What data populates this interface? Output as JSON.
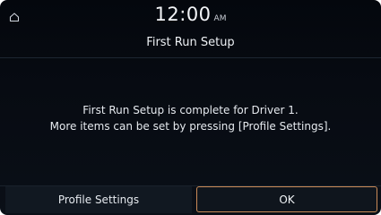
{
  "status_bar": {
    "time": "12:00",
    "ampm": "AM",
    "home_icon": "home-icon"
  },
  "header": {
    "title": "First Run Setup"
  },
  "message": {
    "line1": "First Run Setup is complete for Driver 1.",
    "line2": "More items can be set by pressing [Profile Settings]."
  },
  "footer": {
    "profile_label": "Profile Settings",
    "ok_label": "OK"
  },
  "colors": {
    "background": "#070b12",
    "text": "#e9edf2",
    "ok_border": "#c98a57"
  }
}
